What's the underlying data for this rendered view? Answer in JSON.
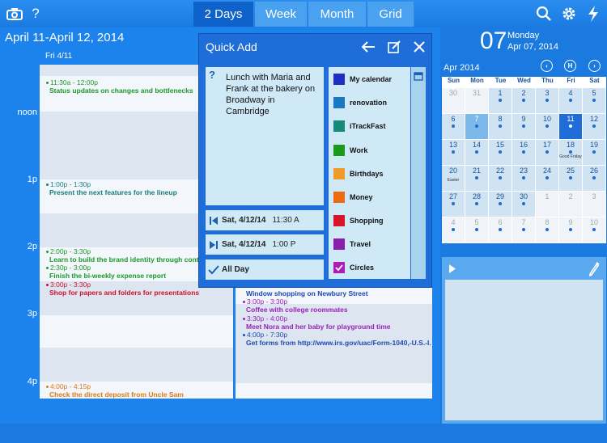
{
  "toolbar": {
    "views": [
      "2 Days",
      "Week",
      "Month",
      "Grid"
    ],
    "active_view": "2 Days"
  },
  "main": {
    "range_title": "April 11-April 12, 2014",
    "day_header": "Fri 4/11",
    "hours": [
      "noon",
      "1p",
      "2p",
      "3p",
      "4p"
    ],
    "events_col1": [
      {
        "time": "11:30a - 12:00p",
        "title": "Status updates on changes and bottlenecks",
        "color": "#1a9a2b"
      },
      {
        "time": "1:00p - 1:30p",
        "title": "Present the next features for the lineup",
        "color": "#137e7e"
      },
      {
        "time": "2:00p - 3:30p",
        "title": "Learn to build the brand identity through content",
        "color": "#1a9a2b"
      },
      {
        "time": "2:30p - 3:00p",
        "title": "Finish the bi-weekly expense report",
        "color": "#1a9a2b"
      },
      {
        "time": "3:00p - 3:30p",
        "title": "Shop for papers and folders for presentations",
        "color": "#d0102a"
      },
      {
        "time": "4:00p - 4:15p",
        "title": "Check the direct deposit from Uncle Sam",
        "color": "#e07a10"
      }
    ],
    "events_col2": [
      {
        "time": "",
        "title": "Window shopping on Newbury Street",
        "color": "#1f49b0"
      },
      {
        "time": "3:00p - 3:30p",
        "title": "Coffee with college roommates",
        "color": "#9a1fb8"
      },
      {
        "time": "3:30p - 4:00p",
        "title": "Meet Nora and her baby for playground time",
        "color": "#9a1fb8"
      },
      {
        "time": "4:00p - 7:30p",
        "title": "Get forms from http://www.irs.gov/uac/Form-1040,-U.S.-I...",
        "color": "#1f49b0"
      }
    ]
  },
  "quick_add": {
    "title": "Quick Add",
    "help_glyph": "?",
    "body": "Lunch with Maria and Frank at the bakery on Broadway in Cambridge",
    "start": {
      "date": "Sat, 4/12/14",
      "time": "11:30 A"
    },
    "end": {
      "date": "Sat, 4/12/14",
      "time": "1:00 P"
    },
    "all_day": "All Day",
    "calendars": [
      {
        "name": "My calendar",
        "color": "#1f2fc2"
      },
      {
        "name": "renovation",
        "color": "#1a78c0"
      },
      {
        "name": "iTrackFast",
        "color": "#168a7a"
      },
      {
        "name": "Work",
        "color": "#1a9a1a"
      },
      {
        "name": "Birthdays",
        "color": "#f09a2a"
      },
      {
        "name": "Money",
        "color": "#ee6a10"
      },
      {
        "name": "Shopping",
        "color": "#d8142a"
      },
      {
        "name": "Travel",
        "color": "#8a1cae"
      },
      {
        "name": "Circles",
        "color": "#b01ab8",
        "checked": true
      }
    ]
  },
  "mini_cal": {
    "big_day": "07",
    "weekday": "Monday",
    "full_date": "Apr 07, 2014",
    "month": "Apr 2014",
    "nav_prev": "‹",
    "nav_home": "H",
    "nav_next": "›",
    "weekdays": [
      "Sun",
      "Mon",
      "Tue",
      "Wed",
      "Thu",
      "Fri",
      "Sat"
    ],
    "cells": [
      {
        "n": "30",
        "dim": true
      },
      {
        "n": "31",
        "dim": true
      },
      {
        "n": "1",
        "dot": true
      },
      {
        "n": "2",
        "dot": true
      },
      {
        "n": "3",
        "dot": true
      },
      {
        "n": "4",
        "dot": true
      },
      {
        "n": "5",
        "dot": true
      },
      {
        "n": "6",
        "dot": true
      },
      {
        "n": "7",
        "dot": true,
        "today": true
      },
      {
        "n": "8",
        "dot": true
      },
      {
        "n": "9",
        "dot": true
      },
      {
        "n": "10",
        "dot": true
      },
      {
        "n": "11",
        "dot": true,
        "sel": true
      },
      {
        "n": "12",
        "dot": true
      },
      {
        "n": "13",
        "dot": true
      },
      {
        "n": "14",
        "dot": true
      },
      {
        "n": "15",
        "dot": true
      },
      {
        "n": "16",
        "dot": true
      },
      {
        "n": "17",
        "dot": true
      },
      {
        "n": "18",
        "dot": true,
        "h": "Good Friday"
      },
      {
        "n": "19",
        "dot": true
      },
      {
        "n": "20",
        "h": "Easter"
      },
      {
        "n": "21",
        "dot": true
      },
      {
        "n": "22",
        "dot": true
      },
      {
        "n": "23",
        "dot": true
      },
      {
        "n": "24",
        "dot": true
      },
      {
        "n": "25",
        "dot": true
      },
      {
        "n": "26",
        "dot": true
      },
      {
        "n": "27",
        "dot": true
      },
      {
        "n": "28",
        "dot": true
      },
      {
        "n": "29",
        "dot": true
      },
      {
        "n": "30",
        "dot": true
      },
      {
        "n": "1",
        "dim": true
      },
      {
        "n": "2",
        "dim": true
      },
      {
        "n": "3",
        "dim": true
      },
      {
        "n": "4",
        "dim": true,
        "dot": true
      },
      {
        "n": "5",
        "dim": true,
        "dot": true
      },
      {
        "n": "6",
        "dim": true,
        "dot": true
      },
      {
        "n": "7",
        "dim": true,
        "dot": true
      },
      {
        "n": "8",
        "dim": true,
        "dot": true
      },
      {
        "n": "9",
        "dim": true,
        "dot": true
      },
      {
        "n": "10",
        "dim": true,
        "dot": true
      }
    ]
  }
}
